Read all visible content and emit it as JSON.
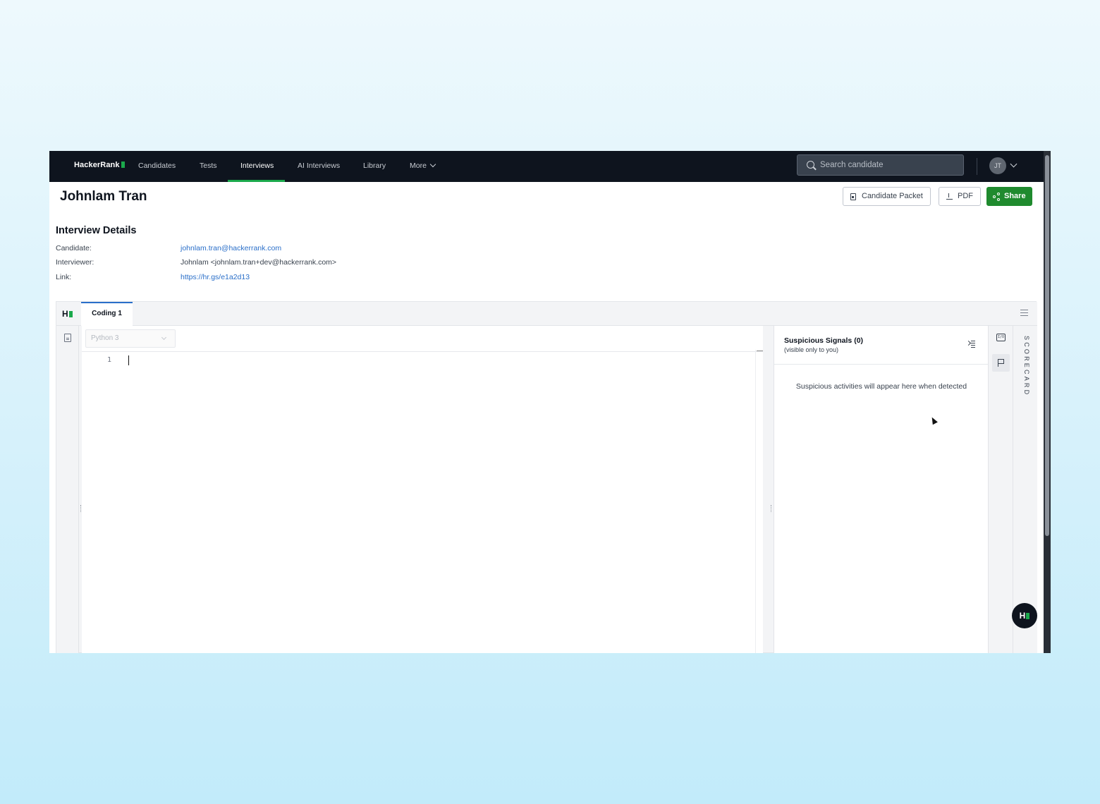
{
  "nav": {
    "logo": "HackerRank",
    "items": [
      "Candidates",
      "Tests",
      "Interviews",
      "AI Interviews",
      "Library",
      "More"
    ],
    "active": "Interviews",
    "search_placeholder": "Search candidate",
    "avatar_initials": "JT"
  },
  "header": {
    "candidate_name": "Johnlam Tran",
    "candidate_packet_label": "Candidate Packet",
    "pdf_label": "PDF",
    "share_label": "Share"
  },
  "details": {
    "title": "Interview Details",
    "candidate_label": "Candidate:",
    "candidate_value": "johnlam.tran@hackerrank.com",
    "interviewer_label": "Interviewer:",
    "interviewer_value": "Johnlam <johnlam.tran+dev@hackerrank.com>",
    "link_label": "Link:",
    "link_value": "https://hr.gs/e1a2d13"
  },
  "ide": {
    "logo": "H",
    "tab_label": "Coding 1",
    "language": "Python 3",
    "line_number": "1"
  },
  "signals": {
    "title": "Suspicious Signals (0)",
    "subtitle": "(visible only to you)",
    "empty_message": "Suspicious activities will appear here when detected"
  },
  "scorecard_label": "SCORECARD",
  "tool_icons": [
    "io-icon",
    "flag-icon"
  ],
  "fab_logo": "H",
  "colors": {
    "nav_bg": "#0e141e",
    "brand_green": "#1ba94c",
    "share_green": "#1f8a2e",
    "link_blue": "#2a6fc9"
  }
}
